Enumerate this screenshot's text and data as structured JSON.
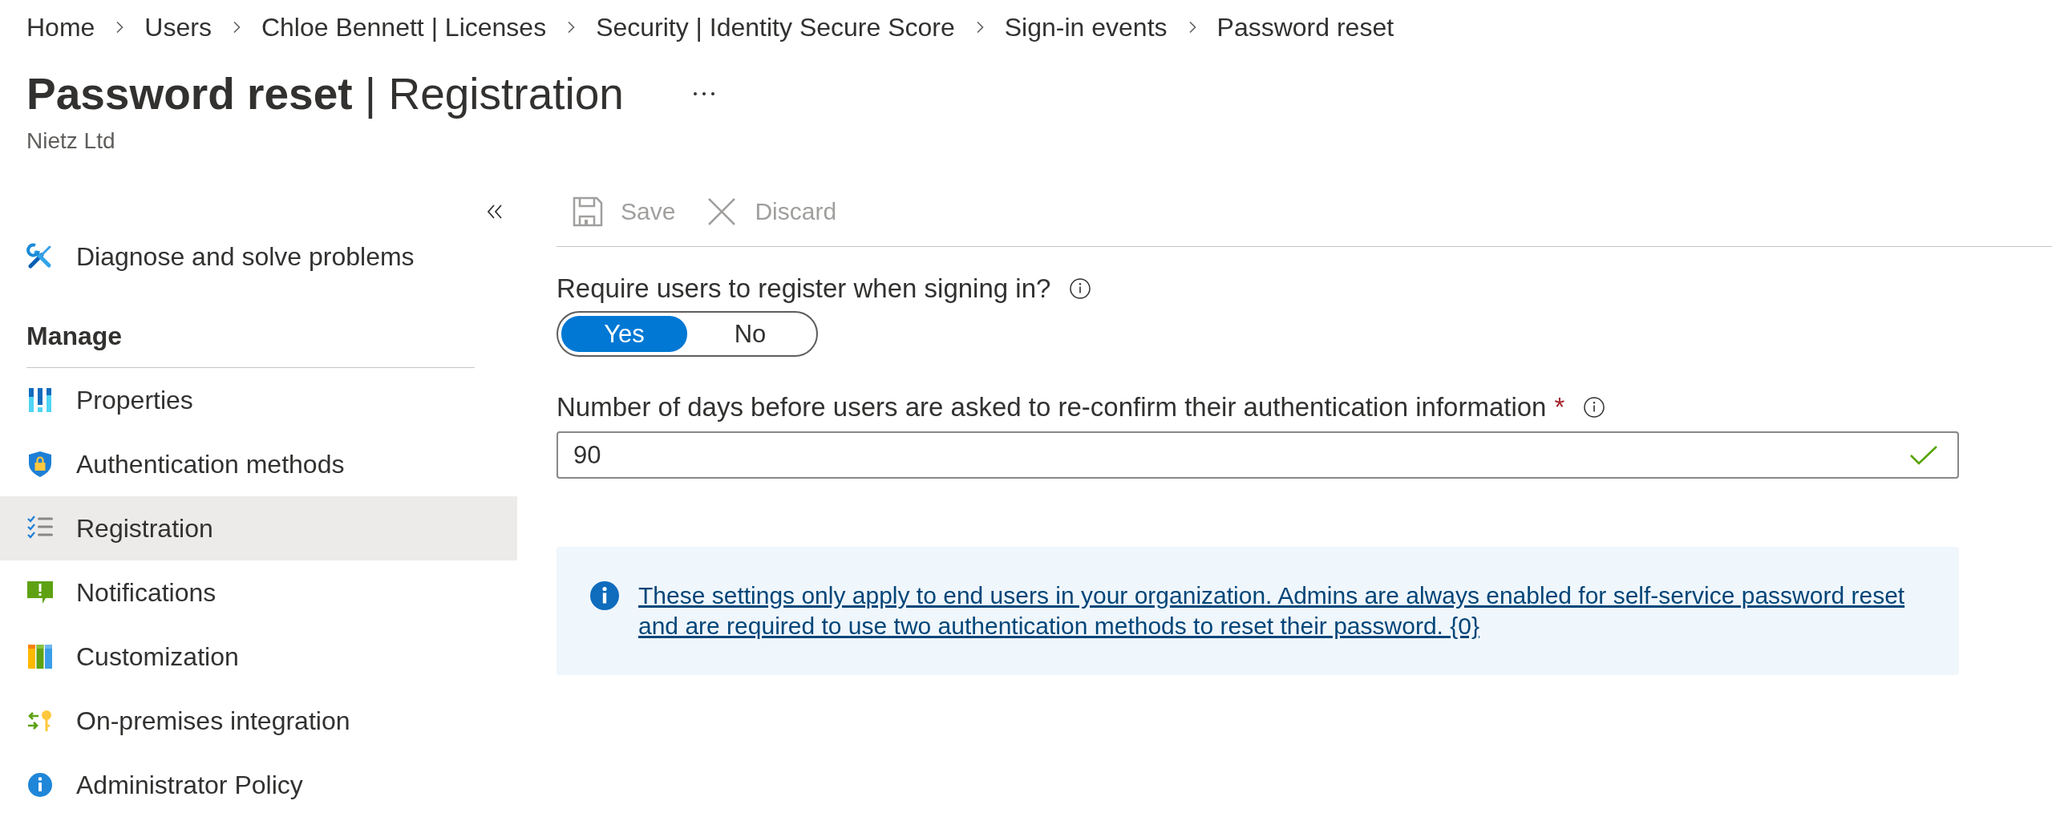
{
  "breadcrumb": [
    "Home",
    "Users",
    "Chloe Bennett | Licenses",
    "Security | Identity Secure Score",
    "Sign-in events",
    "Password reset"
  ],
  "header": {
    "title": "**Password reset** | Registration",
    "subtitle": "Nietz Ltd"
  },
  "sidebar": {
    "items": [
      {
        "label": "Diagnose and solve problems",
        "selected": false
      }
    ],
    "sections": [
      {
        "heading": "Manage",
        "items": [
          {
            "label": "Properties",
            "selected": false
          },
          {
            "label": "Authentication methods",
            "selected": false
          },
          {
            "label": "Registration",
            "selected": true
          },
          {
            "label": "Notifications",
            "selected": false
          },
          {
            "label": "Customization",
            "selected": false
          },
          {
            "label": "On-premises integration",
            "selected": false
          },
          {
            "label": "Administrator Policy",
            "selected": false
          }
        ]
      }
    ]
  },
  "toolbar": {
    "buttons": [
      {
        "label": "Save",
        "disabled": true
      },
      {
        "label": "Discard",
        "disabled": true
      }
    ]
  },
  "form": {
    "fields": [
      {
        "kind": "toggle",
        "label": "Require users to register when signing in?",
        "options": [
          {
            "label": "Yes",
            "selected": true
          },
          {
            "label": "No",
            "selected": false
          }
        ]
      },
      {
        "kind": "number",
        "label": "Number of days before users are asked to re-confirm their authentication information",
        "required_mark": "*",
        "value": "90",
        "valid": true
      }
    ]
  },
  "info_banner": {
    "text": "These settings only apply to end users in your organization. Admins are always enabled for self-service password reset and are required to use two authentication methods to reset their password. {0}"
  }
}
